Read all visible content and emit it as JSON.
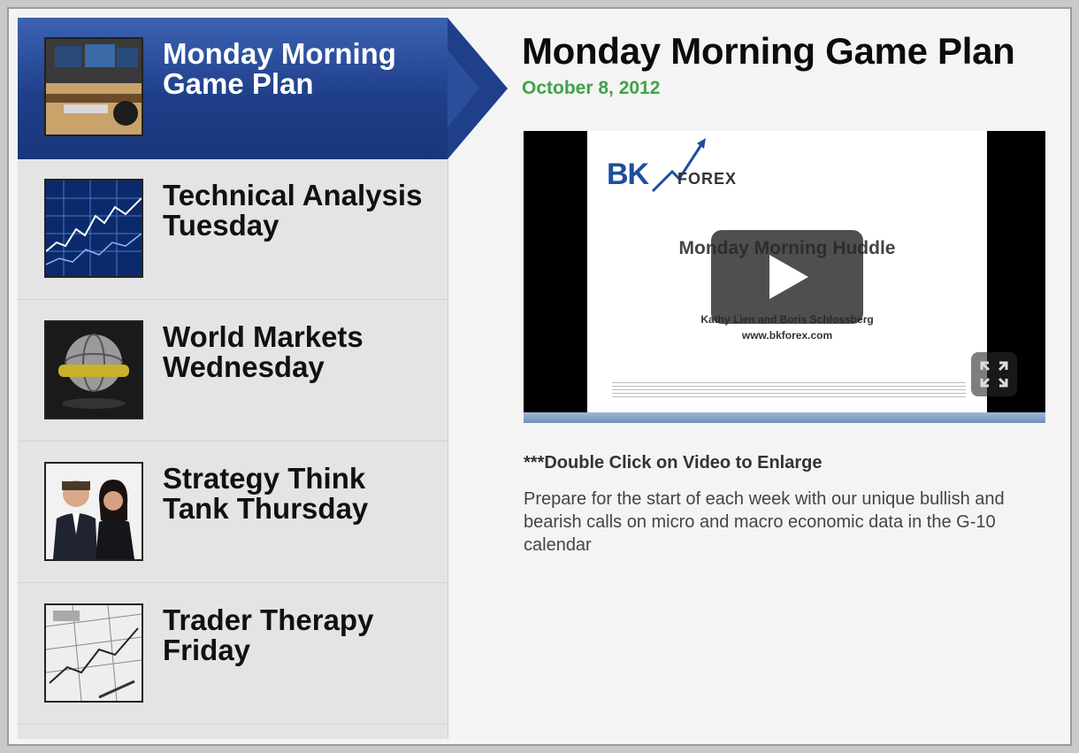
{
  "sidebar": {
    "items": [
      {
        "label": "Monday Morning Game Plan",
        "active": true
      },
      {
        "label": "Technical Analysis Tuesday",
        "active": false
      },
      {
        "label": "World Markets Wednesday",
        "active": false
      },
      {
        "label": "Strategy Think Tank Thursday",
        "active": false
      },
      {
        "label": "Trader Therapy Friday",
        "active": false
      }
    ]
  },
  "main": {
    "title": "Monday Morning Game Plan",
    "date": "October 8, 2012",
    "video": {
      "logo_bk": "BK",
      "logo_forex": "FOREX",
      "slide_title": "Monday Morning Huddle",
      "slide_authors": "Kathy Lien and Boris Schlossberg",
      "slide_url": "www.bkforex.com"
    },
    "hint": "***Double Click on Video to Enlarge",
    "description": "Prepare for the start of each week with our unique bullish and bearish calls on micro and macro economic data in the G-10 calendar"
  },
  "colors": {
    "active_nav": "#1f3f8a",
    "date_green": "#3fa34a",
    "logo_blue": "#1f4e9c"
  }
}
